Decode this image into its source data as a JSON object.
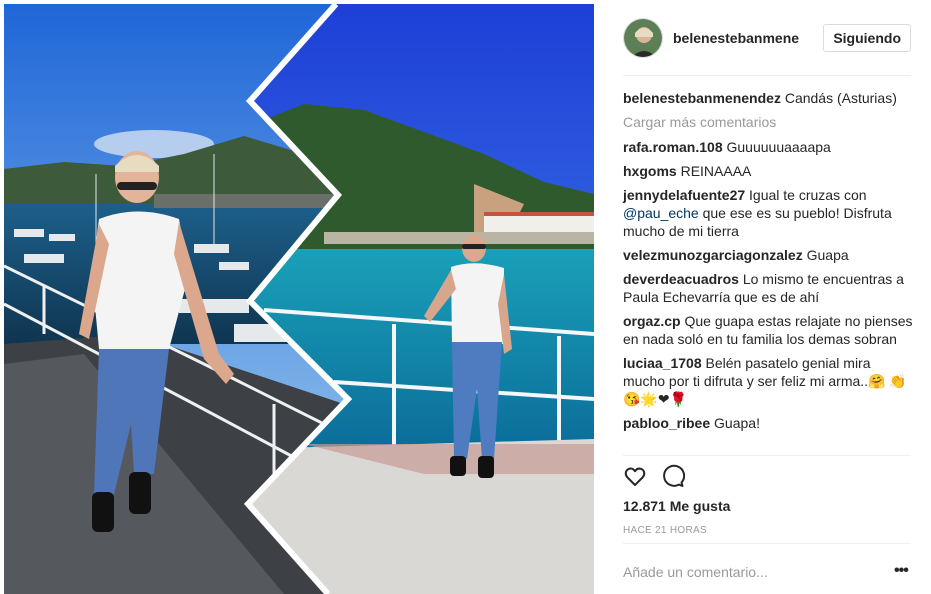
{
  "header": {
    "username": "belenestebanmene",
    "follow_label": "Siguiendo"
  },
  "caption": {
    "username": "belenestebanmenendez",
    "text": "Candás (Asturias)"
  },
  "load_more": "Cargar más comentarios",
  "comments": [
    {
      "user": "rafa.roman.108",
      "text": "Guuuuuuaaaapa"
    },
    {
      "user": "hxgoms",
      "text": "REINAAAA"
    },
    {
      "user": "jennydelafuente27",
      "text_before": "Igual te cruzas con",
      "mention": "@pau_eche",
      "text_after": "que ese es su pueblo! Disfruta mucho de mi tierra"
    },
    {
      "user": "velezmunozgarciagonzalez",
      "text": "Guapa"
    },
    {
      "user": "deverdeacuadros",
      "text": "Lo mismo te encuentras a Paula Echevarría que es de ahí"
    },
    {
      "user": "orgaz.cp",
      "text": "Que guapa estas relajate no pienses en nada soló en tu familia los demas sobran"
    },
    {
      "user": "luciaa_1708",
      "text": "Belén pasatelo genial mira mucho por ti difruta y ser feliz mi arma..🤗",
      "emojis": "👏😘🌟❤🌹"
    },
    {
      "user": "pabloo_ribee",
      "text": "Guapa!"
    }
  ],
  "actions": {
    "like_icon": "heart-icon",
    "comment_icon": "comment-bubble-icon"
  },
  "likes": {
    "count": "12.871",
    "label": "Me gusta"
  },
  "timestamp": "HACE 21 HORAS",
  "add_comment": {
    "placeholder": "Añade un comentario...",
    "more": "•••"
  },
  "colors": {
    "mention": "#003569",
    "muted": "#999999",
    "border": "#dbdbdb"
  }
}
